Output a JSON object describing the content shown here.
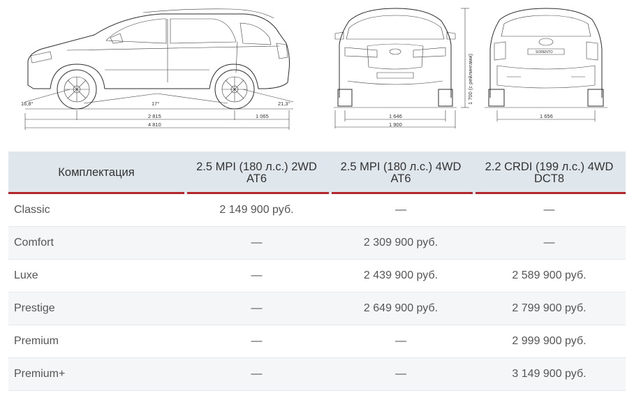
{
  "drawings": {
    "side": {
      "approach_angle": "16,8°",
      "ramp_angle": "17°",
      "departure_angle": "21,3°",
      "wheelbase": "2 815",
      "rear_overhang": "1 065",
      "length": "4 810"
    },
    "front": {
      "track": "1 646",
      "width": "1 900",
      "height": "1 700 (с рейлингами)"
    },
    "rear": {
      "track": "1 656",
      "badge": "SORENTO"
    }
  },
  "table": {
    "headers": [
      "Комплектация",
      "2.5 MPI (180 л.с.) 2WD AT6",
      "2.5 MPI (180 л.с.) 4WD AT6",
      "2.2 CRDI (199 л.с.) 4WD DCT8"
    ],
    "rows": [
      [
        "Classic",
        "2 149 900 руб.",
        "—",
        "—"
      ],
      [
        "Comfort",
        "—",
        "2 309 900 руб.",
        "—"
      ],
      [
        "Luxe",
        "—",
        "2 439 900 руб.",
        "2 589 900 руб."
      ],
      [
        "Prestige",
        "—",
        "2 649 900 руб.",
        "2 799 900 руб."
      ],
      [
        "Premium",
        "—",
        "—",
        "2 999 900 руб."
      ],
      [
        "Premium+",
        "—",
        "—",
        "3 149 900 руб."
      ]
    ]
  },
  "colors": {
    "header_bg": "#dfe6ec",
    "accent_red": "#b3262b",
    "row_alt_bg": "#f4f6f8"
  }
}
